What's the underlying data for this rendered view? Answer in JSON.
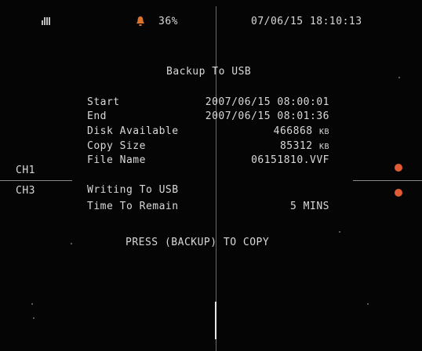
{
  "status_bar": {
    "hdd_icon": "hdd-bars-icon",
    "alarm_icon": "alarm-bell-icon",
    "disk_percent": "36%",
    "datetime": "07/06/15 18:10:13"
  },
  "dialog": {
    "title": "Backup To USB",
    "rows": [
      {
        "label": "Start",
        "value": "2007/06/15 08:00:01"
      },
      {
        "label": "End",
        "value": "2007/06/15 08:01:36"
      },
      {
        "label": "Disk Available",
        "value": "466868",
        "unit": "KB"
      },
      {
        "label": "Copy Size",
        "value": "85312",
        "unit": "KB"
      },
      {
        "label": "File Name",
        "value": "06151810.VVF"
      },
      {
        "label": "Writing To USB",
        "value": ""
      },
      {
        "label": "Time To Remain",
        "value": "5 MINS"
      }
    ],
    "prompt": "PRESS (BACKUP) TO COPY"
  },
  "channels": {
    "ch1": "CH1",
    "ch3": "CH3"
  },
  "colors": {
    "background": "#050505",
    "text": "#d9d9d9",
    "record_dot": "#e25b35",
    "alarm_icon": "#d9742e"
  }
}
